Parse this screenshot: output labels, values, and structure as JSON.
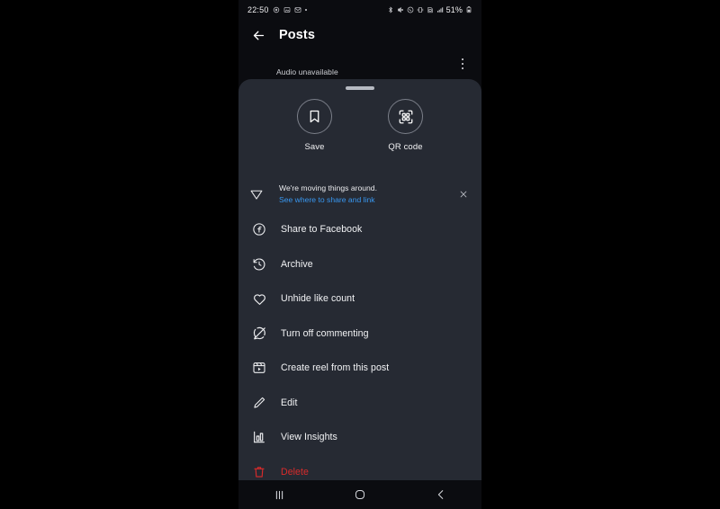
{
  "status_bar": {
    "time": "22:50",
    "left_icons": [
      "location-icon",
      "screenshot-icon",
      "gmail-icon",
      "dot-icon"
    ],
    "right_icons": [
      "bluetooth-icon",
      "mute-icon",
      "wifi-calling-icon",
      "vibrate-icon",
      "sim-icon",
      "signal-icon"
    ],
    "battery": "51%",
    "battery_icon": "battery-icon"
  },
  "app_bar": {
    "back_icon": "back-arrow-icon",
    "title": "Posts",
    "kebab_icon": "more-options-icon"
  },
  "post": {
    "audio_status": "Audio unavailable"
  },
  "sheet": {
    "handle": "drag-handle",
    "quick_actions": [
      {
        "label": "Save",
        "icon": "bookmark-icon"
      },
      {
        "label": "QR code",
        "icon": "qr-code-icon"
      }
    ],
    "notice": {
      "icon": "send-paper-plane-icon",
      "title": "We're moving things around.",
      "link": "See where to share and link",
      "close_icon": "close-icon"
    },
    "menu_items": [
      {
        "label": "Share to Facebook",
        "icon": "facebook-icon",
        "danger": false
      },
      {
        "label": "Archive",
        "icon": "archive-clock-icon",
        "danger": false
      },
      {
        "label": "Unhide like count",
        "icon": "heart-icon",
        "danger": false
      },
      {
        "label": "Turn off commenting",
        "icon": "comment-off-icon",
        "danger": false
      },
      {
        "label": "Create reel from this post",
        "icon": "reel-icon",
        "danger": false
      },
      {
        "label": "Edit",
        "icon": "pencil-icon",
        "danger": false
      },
      {
        "label": "View Insights",
        "icon": "insights-bar-chart-icon",
        "danger": false
      },
      {
        "label": "Delete",
        "icon": "trash-icon",
        "danger": true
      }
    ]
  },
  "nav_bar": {
    "recents_icon": "recents-icon",
    "home_icon": "home-icon",
    "back_icon": "nav-back-icon"
  },
  "colors": {
    "sheet_bg": "#262a33",
    "screen_bg": "#0b0c10",
    "link": "#3897f0",
    "danger": "#d92b2b",
    "text": "#f2f3f5"
  }
}
